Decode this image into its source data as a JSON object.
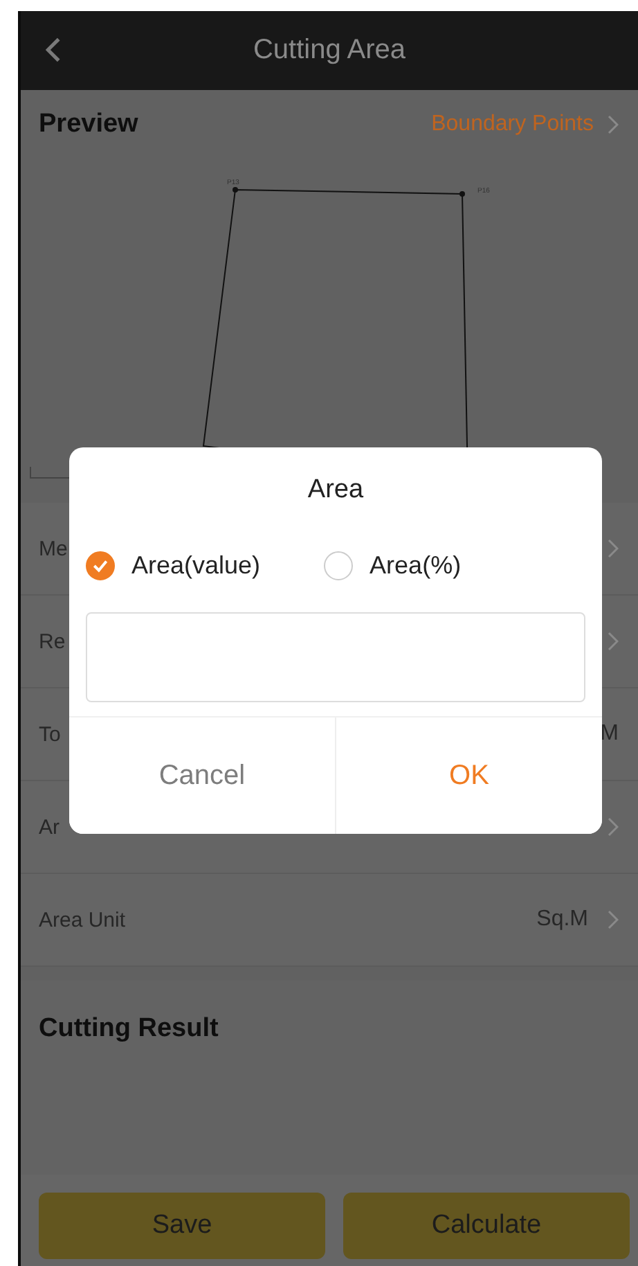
{
  "top_bar": {
    "title": "Cutting Area"
  },
  "preview": {
    "title": "Preview",
    "link": "Boundary Points",
    "points": [
      {
        "label": "P13"
      },
      {
        "label": "P16"
      }
    ]
  },
  "settings": [
    {
      "label": "Me",
      "chevron": true
    },
    {
      "label": "Re",
      "chevron": true
    },
    {
      "label": "To",
      "value": "M",
      "chevron": false
    },
    {
      "label": "Ar",
      "chevron": true
    },
    {
      "label": "Area Unit",
      "value": "Sq.M",
      "chevron": true
    }
  ],
  "result": {
    "title": "Cutting Result"
  },
  "actions": [
    "Save",
    "Calculate"
  ],
  "dialog": {
    "title": "Area",
    "options": [
      {
        "label": "Area(value)",
        "selected": true
      },
      {
        "label": "Area(%)",
        "selected": false
      }
    ],
    "buttons": [
      {
        "label": "Cancel",
        "kind": "cancel"
      },
      {
        "label": "OK",
        "kind": "confirm"
      }
    ]
  }
}
